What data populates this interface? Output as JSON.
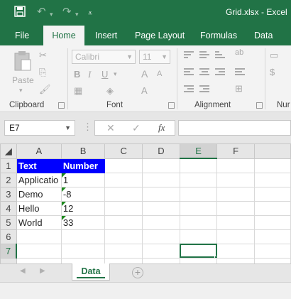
{
  "window": {
    "title": "Grid.xlsx - Excel"
  },
  "quick_access": {
    "save_icon": "save-icon",
    "undo_icon": "undo-icon",
    "redo_icon": "redo-icon",
    "customize_icon": "customize-qat-icon"
  },
  "ribbon_tabs": [
    "File",
    "Home",
    "Insert",
    "Page Layout",
    "Formulas",
    "Data"
  ],
  "active_tab": "Home",
  "ribbon": {
    "clipboard": {
      "label": "Clipboard",
      "paste_label": "Paste"
    },
    "font": {
      "label": "Font",
      "font_name": "Calibri",
      "font_size": "11",
      "bold": "B",
      "italic": "I",
      "underline": "U",
      "grow": "A",
      "shrink": "A"
    },
    "alignment": {
      "label": "Alignment"
    },
    "number": {
      "label": "Nur"
    }
  },
  "formula_bar": {
    "name_box": "E7",
    "cancel": "✕",
    "enter": "✓",
    "fx": "fx",
    "formula": ""
  },
  "grid": {
    "columns": [
      "A",
      "B",
      "C",
      "D",
      "E",
      "F"
    ],
    "rows": [
      {
        "n": "1",
        "a": "Text",
        "b": "Number"
      },
      {
        "n": "2",
        "a": "Applicatio",
        "b": "1"
      },
      {
        "n": "3",
        "a": "Demo",
        "b": "-8"
      },
      {
        "n": "4",
        "a": "Hello",
        "b": "12"
      },
      {
        "n": "5",
        "a": "World",
        "b": "33"
      },
      {
        "n": "6",
        "a": "",
        "b": ""
      },
      {
        "n": "7",
        "a": "",
        "b": ""
      }
    ],
    "selected_cell": "E7"
  },
  "sheets": {
    "tabs": [
      "Data"
    ],
    "active": "Data"
  },
  "colors": {
    "excel_green": "#217346",
    "header_fill": "#0000ff",
    "header_text": "#ffffff"
  }
}
